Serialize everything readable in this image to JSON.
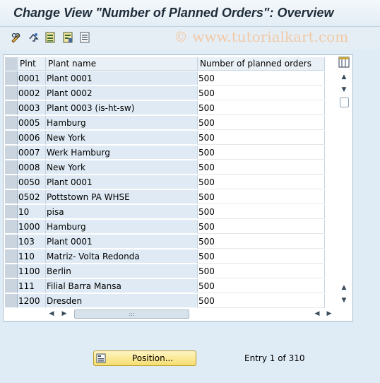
{
  "window": {
    "title": "Change View \"Number of Planned Orders\": Overview"
  },
  "watermark": "© www.tutorialkart.com",
  "toolbar": {
    "icons": [
      "edit-glasses-icon",
      "undo-icon",
      "select-all-icon",
      "deselect-icon",
      "details-icon"
    ]
  },
  "table": {
    "headers": {
      "plnt": "Plnt",
      "name": "Plant name",
      "num": "Number of planned orders"
    },
    "rows": [
      {
        "plnt": "0001",
        "name": "Plant 0001",
        "num": "500"
      },
      {
        "plnt": "0002",
        "name": "Plant 0002",
        "num": "500"
      },
      {
        "plnt": "0003",
        "name": "Plant 0003 (is-ht-sw)",
        "num": "500"
      },
      {
        "plnt": "0005",
        "name": "Hamburg",
        "num": "500"
      },
      {
        "plnt": "0006",
        "name": "New York",
        "num": "500"
      },
      {
        "plnt": "0007",
        "name": "Werk Hamburg",
        "num": "500"
      },
      {
        "plnt": "0008",
        "name": "New York",
        "num": "500"
      },
      {
        "plnt": "0050",
        "name": "Plant 0001",
        "num": "500"
      },
      {
        "plnt": "0502",
        "name": "Pottstown PA WHSE",
        "num": "500"
      },
      {
        "plnt": "10",
        "name": "pisa",
        "num": "500"
      },
      {
        "plnt": "1000",
        "name": "Hamburg",
        "num": "500"
      },
      {
        "plnt": "103",
        "name": "Plant 0001",
        "num": "500"
      },
      {
        "plnt": "110",
        "name": "Matriz- Volta Redonda",
        "num": "500"
      },
      {
        "plnt": "1100",
        "name": "Berlin",
        "num": "500"
      },
      {
        "plnt": "111",
        "name": "Filial Barra Mansa",
        "num": "500"
      },
      {
        "plnt": "1200",
        "name": "Dresden",
        "num": "500"
      }
    ]
  },
  "footer": {
    "position_button": "Position...",
    "entry_text": "Entry 1 of 310"
  }
}
